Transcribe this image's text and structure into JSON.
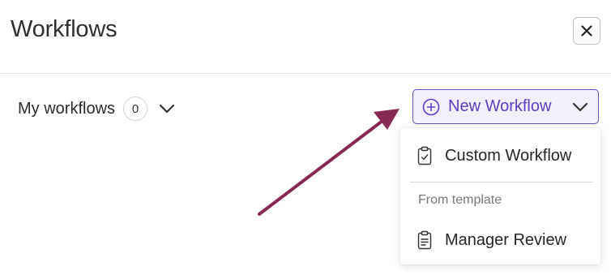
{
  "header": {
    "title": "Workflows"
  },
  "filter": {
    "label": "My workflows",
    "count": "0"
  },
  "new_workflow": {
    "label": "New Workflow",
    "accent_color": "#5b3fc4",
    "background_color": "#f3effc"
  },
  "dropdown": {
    "items": [
      {
        "label": "Custom Workflow",
        "icon": "clipboard-check-icon"
      }
    ],
    "section_label": "From template",
    "templates": [
      {
        "label": "Manager Review",
        "icon": "clipboard-list-icon"
      }
    ]
  },
  "annotation": {
    "arrow_color": "#862a55"
  }
}
